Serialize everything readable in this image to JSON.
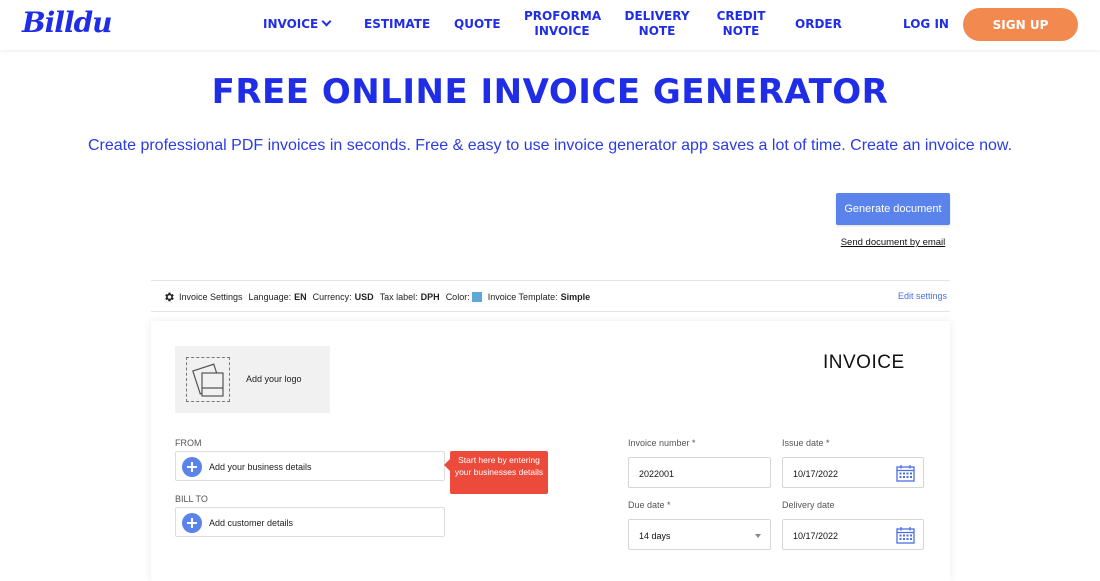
{
  "brand": {
    "logo_text": "Billdu",
    "accent": "#1f2ee6",
    "signup_color": "#f2894f"
  },
  "nav": {
    "items": [
      {
        "label": "INVOICE",
        "has_dropdown": true
      },
      {
        "label": "ESTIMATE"
      },
      {
        "label": "QUOTE"
      },
      {
        "label": "PROFORMA INVOICE"
      },
      {
        "label": "DELIVERY NOTE"
      },
      {
        "label": "CREDIT NOTE"
      },
      {
        "label": "ORDER"
      }
    ],
    "login": "LOG IN",
    "signup": "SIGN UP"
  },
  "hero": {
    "title": "FREE ONLINE INVOICE GENERATOR",
    "subtitle": "Create professional PDF invoices in seconds. Free & easy to use invoice generator app saves a lot of time. Create an invoice now."
  },
  "actions": {
    "generate": "Generate document",
    "send_email": "Send document by email"
  },
  "settings": {
    "title": "Invoice Settings",
    "language_label": "Language:",
    "language": "EN",
    "currency_label": "Currency:",
    "currency": "USD",
    "tax_label_label": "Tax label:",
    "tax_label": "DPH",
    "color_label": "Color:",
    "color": "#5fa8d6",
    "template_label": "Invoice Template:",
    "template": "Simple",
    "edit": "Edit settings"
  },
  "invoice": {
    "logo_label": "Add your logo",
    "title": "INVOICE",
    "from_label": "FROM",
    "from_action": "Add your business details",
    "tooltip": "Start here by entering your businesses details",
    "bill_to_label": "BILL TO",
    "bill_to_action": "Add customer details",
    "invoice_number_label": "Invoice number *",
    "invoice_number": "2022001",
    "issue_date_label": "Issue date *",
    "issue_date": "10/17/2022",
    "due_date_label": "Due date *",
    "due_date": "14 days",
    "delivery_date_label": "Delivery date",
    "delivery_date": "10/17/2022"
  }
}
